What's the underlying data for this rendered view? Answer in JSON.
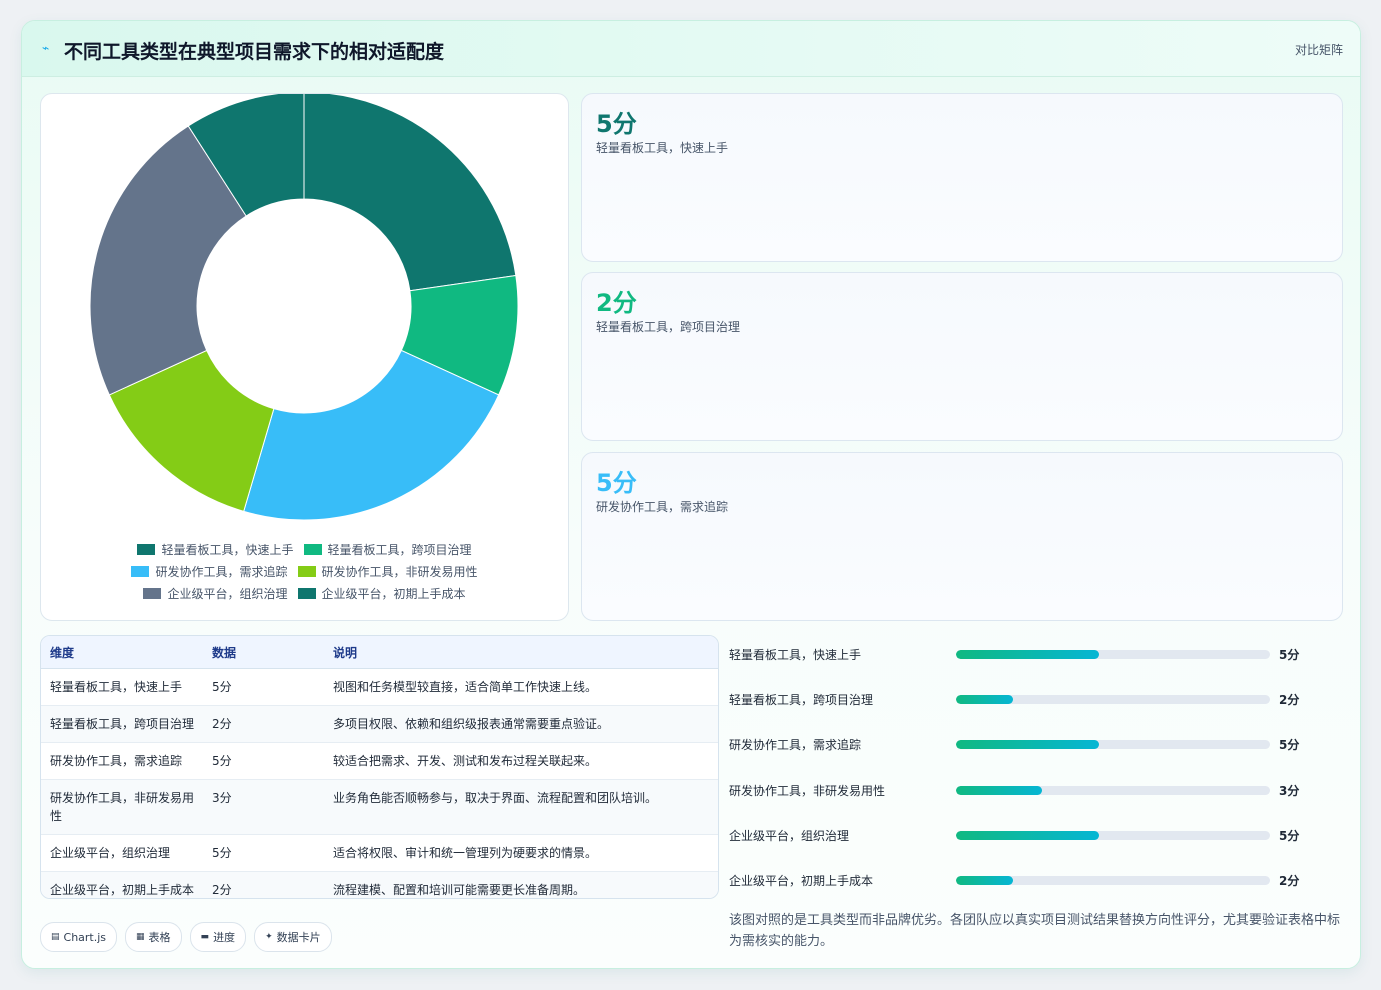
{
  "header": {
    "title": "不同工具类型在典型项目需求下的相对适配度",
    "tag": "对比矩阵"
  },
  "stats": [
    {
      "value": "5分",
      "label": "轻量看板工具，快速上手",
      "color": "#0f766e"
    },
    {
      "value": "2分",
      "label": "轻量看板工具，跨项目治理",
      "color": "#10b981"
    },
    {
      "value": "5分",
      "label": "研发协作工具，需求追踪",
      "color": "#38bdf8"
    }
  ],
  "chart_data": {
    "type": "pie",
    "categories": [
      "轻量看板工具，快速上手",
      "轻量看板工具，跨项目治理",
      "研发协作工具，需求追踪",
      "研发协作工具，非研发易用性",
      "企业级平台，组织治理",
      "企业级平台，初期上手成本"
    ],
    "values": [
      5,
      2,
      5,
      3,
      5,
      2
    ],
    "colors": [
      "#0f766e",
      "#10b981",
      "#38bdf8",
      "#84cc16",
      "#64748b",
      "#0f766e"
    ],
    "donut": true,
    "legend": "bottom"
  },
  "table": {
    "headers": [
      "维度",
      "数据",
      "说明"
    ],
    "rows": [
      [
        "轻量看板工具，快速上手",
        "5分",
        "视图和任务模型较直接，适合简单工作快速上线。"
      ],
      [
        "轻量看板工具，跨项目治理",
        "2分",
        "多项目权限、依赖和组织级报表通常需要重点验证。"
      ],
      [
        "研发协作工具，需求追踪",
        "5分",
        "较适合把需求、开发、测试和发布过程关联起来。"
      ],
      [
        "研发协作工具，非研发易用性",
        "3分",
        "业务角色能否顺畅参与，取决于界面、流程配置和团队培训。"
      ],
      [
        "企业级平台，组织治理",
        "5分",
        "适合将权限、审计和统一管理列为硬要求的情景。"
      ],
      [
        "企业级平台，初期上手成本",
        "2分",
        "流程建模、配置和培训可能需要更长准备周期。"
      ]
    ]
  },
  "progress": {
    "max": 11,
    "items": [
      {
        "label": "轻量看板工具，快速上手",
        "value": 5,
        "text": "5分"
      },
      {
        "label": "轻量看板工具，跨项目治理",
        "value": 2,
        "text": "2分"
      },
      {
        "label": "研发协作工具，需求追踪",
        "value": 5,
        "text": "5分"
      },
      {
        "label": "研发协作工具，非研发易用性",
        "value": 3,
        "text": "3分"
      },
      {
        "label": "企业级平台，组织治理",
        "value": 5,
        "text": "5分"
      },
      {
        "label": "企业级平台，初期上手成本",
        "value": 2,
        "text": "2分"
      }
    ]
  },
  "note": "该图对照的是工具类型而非品牌优劣。各团队应以真实项目测试结果替换方向性评分，尤其要验证表格中标为需核实的能力。",
  "chips": [
    {
      "icon": "▤",
      "icon_name": "chart-icon",
      "label": "Chart.js"
    },
    {
      "icon": "▦",
      "icon_name": "table-icon",
      "label": "表格"
    },
    {
      "icon": "▬",
      "icon_name": "progress-icon",
      "label": "进度"
    },
    {
      "icon": "✦",
      "icon_name": "sparkle-icon",
      "label": "数据卡片"
    }
  ]
}
